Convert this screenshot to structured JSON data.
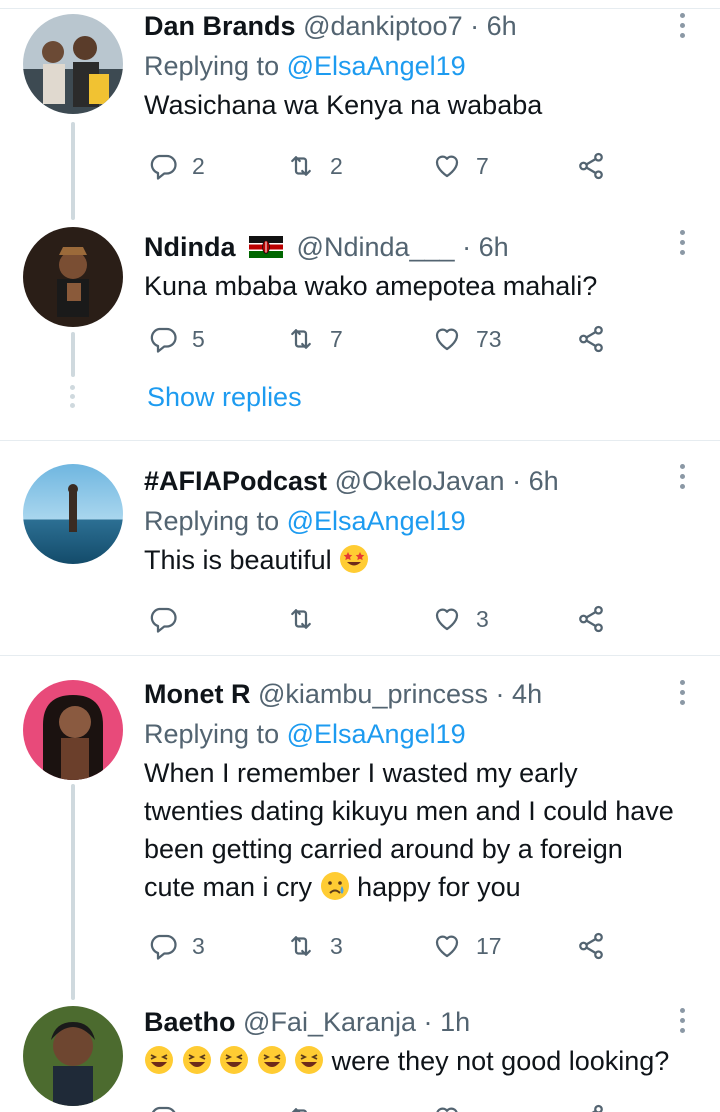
{
  "tweets": [
    {
      "name": "Dan Brands",
      "handle": "@dankiptoo7",
      "sep": "·",
      "time": "6h",
      "replying_label": "Replying to",
      "replying_to": "@ElsaAngel19",
      "text": "Wasichana wa Kenya na wababa",
      "replies": "2",
      "retweets": "2",
      "likes": "7"
    },
    {
      "name": "Ndinda",
      "handle": "@Ndinda___",
      "sep": "·",
      "time": "6h",
      "text": "Kuna mbaba wako amepotea mahali?",
      "replies": "5",
      "retweets": "7",
      "likes": "73"
    },
    {
      "name": "#AFIAPodcast",
      "handle": "@OkeloJavan",
      "sep": "·",
      "time": "6h",
      "replying_label": "Replying to",
      "replying_to": "@ElsaAngel19",
      "text": "This is beautiful",
      "replies": "",
      "retweets": "",
      "likes": "3"
    },
    {
      "name": "Monet R",
      "handle": "@kiambu_princess",
      "sep": "·",
      "time": "4h",
      "replying_label": "Replying to",
      "replying_to": "@ElsaAngel19",
      "text_line1": "When I remember I wasted my early",
      "text_line2": "twenties dating kikuyu men and I could have",
      "text_line3": "been getting carried around by a foreign",
      "text_line4a": "cute man i cry",
      "text_line4b": "happy for you",
      "replies": "3",
      "retweets": "3",
      "likes": "17"
    },
    {
      "name": "Baetho",
      "handle": "@Fai_Karanja",
      "sep": "·",
      "time": "1h",
      "text": "were they not good looking?"
    }
  ],
  "show_replies": "Show replies",
  "colors": {
    "accent": "#1d9bf0",
    "muted": "#536471",
    "divider": "#e6ecf0",
    "thread_line": "#cfd9de"
  },
  "icons": {
    "reply": "reply-icon",
    "retweet": "retweet-icon",
    "like": "heart-icon",
    "share": "share-icon",
    "more": "more-options-icon"
  }
}
